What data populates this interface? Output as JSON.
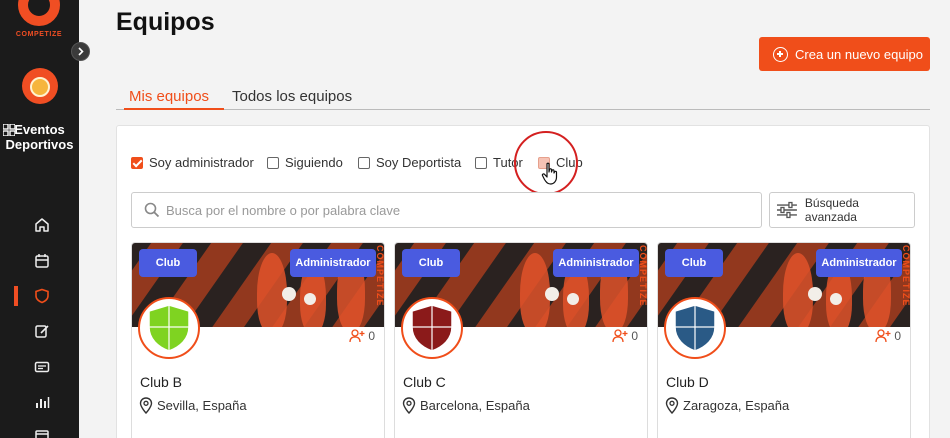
{
  "app": {
    "logo_text": "COMPETIZE",
    "brand_color": "#f04e1a"
  },
  "sidebar": {
    "section_label": "Eventos Deportivos",
    "section_icon": "grid-icon",
    "nav_icons": [
      "home-icon",
      "calendar-icon",
      "shield-icon",
      "edit-icon",
      "id-card-icon",
      "bar-chart-icon",
      "document-icon"
    ],
    "active_index": 2
  },
  "header": {
    "title": "Equipos",
    "create_button_label": "Crea un nuevo equipo"
  },
  "tabs": [
    {
      "label": "Mis equipos",
      "active": true
    },
    {
      "label": "Todos los equipos",
      "active": false
    }
  ],
  "filters": [
    {
      "label": "Soy administrador",
      "checked": true
    },
    {
      "label": "Siguiendo",
      "checked": false
    },
    {
      "label": "Soy Deportista",
      "checked": false
    },
    {
      "label": "Tutor",
      "checked": false
    },
    {
      "label": "Club",
      "checked": false,
      "hovered": true
    }
  ],
  "search": {
    "placeholder": "Busca por el nombre o por palabra clave",
    "advanced_label": "Búsqueda avanzada"
  },
  "cards": [
    {
      "type_badge": "Club",
      "role_badge": "Administrador",
      "name": "Club B",
      "location": "Sevilla, España",
      "members": "0",
      "crest_color": "#7fd321"
    },
    {
      "type_badge": "Club",
      "role_badge": "Administrador",
      "name": "Club C",
      "location": "Barcelona, España",
      "members": "0",
      "crest_color": "#8b1a1a"
    },
    {
      "type_badge": "Club",
      "role_badge": "Administrador",
      "name": "Club D",
      "location": "Zaragoza, España",
      "members": "0",
      "crest_color": "#2a5a86"
    }
  ],
  "banner_brand": "COMPETIZE"
}
